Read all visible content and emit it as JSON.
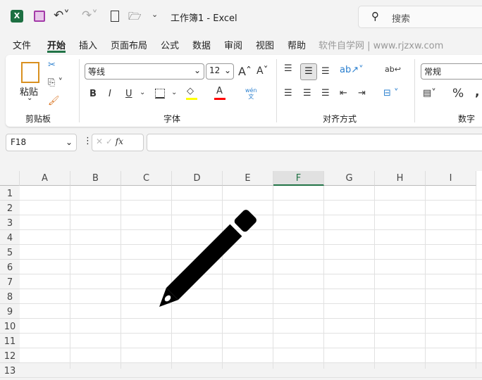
{
  "titlebar": {
    "title": "工作簿1  -  Excel",
    "search_placeholder": "搜索"
  },
  "menu": [
    "文件",
    "开始",
    "插入",
    "页面布局",
    "公式",
    "数据",
    "审阅",
    "视图",
    "帮助"
  ],
  "watermark": "软件自学网 | www.rjzxw.com",
  "ribbon": {
    "clipboard": {
      "paste": "粘贴",
      "label": "剪贴板"
    },
    "font": {
      "name": "等线",
      "size": "12",
      "bold": "B",
      "italic": "I",
      "underline": "U",
      "label": "字体",
      "phonetic": "wén"
    },
    "alignment": {
      "label": "对齐方式"
    },
    "number": {
      "format": "常规",
      "percent": "%",
      "label": "数字"
    }
  },
  "formula_bar": {
    "name_box": "F18",
    "fx": "fx",
    "value": ""
  },
  "columns": [
    "A",
    "B",
    "C",
    "D",
    "E",
    "F",
    "G",
    "H",
    "I"
  ],
  "selected_column": "F",
  "rows": [
    "1",
    "2",
    "3",
    "4",
    "5",
    "6",
    "7",
    "8",
    "9",
    "10",
    "11",
    "12",
    "13"
  ],
  "colors": {
    "accent": "#217346",
    "highlight": "#ffff00",
    "font_color": "#ff0000"
  }
}
